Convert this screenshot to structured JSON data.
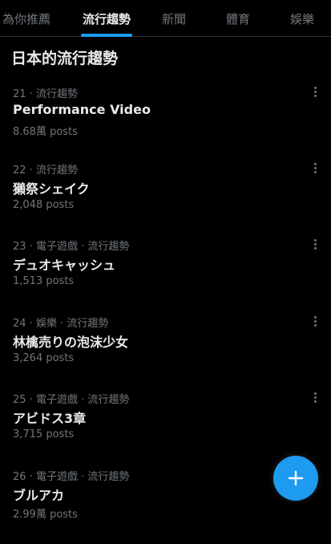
{
  "tabs": [
    {
      "label": "為你推薦",
      "active": false
    },
    {
      "label": "流行趨勢",
      "active": true
    },
    {
      "label": "新聞",
      "active": false
    },
    {
      "label": "體育",
      "active": false
    },
    {
      "label": "娛樂",
      "active": false
    }
  ],
  "section_title": "日本的流行趨勢",
  "trends": [
    {
      "rank": "21",
      "category": "流行趨勢",
      "name": "Performance Video",
      "posts": "8.68萬 posts"
    },
    {
      "rank": "22",
      "category": "流行趨勢",
      "name": "獺祭シェイク",
      "posts": "2,048 posts"
    },
    {
      "rank": "23",
      "category": "電子遊戲 · 流行趨勢",
      "name": "デュオキャッシュ",
      "posts": "1,513 posts"
    },
    {
      "rank": "24",
      "category": "娛樂 · 流行趨勢",
      "name": "林檎売りの泡沫少女",
      "posts": "3,264 posts"
    },
    {
      "rank": "25",
      "category": "電子遊戲 · 流行趨勢",
      "name": "アビドス3章",
      "posts": "3,715 posts"
    },
    {
      "rank": "26",
      "category": "電子遊戲 · 流行趨勢",
      "name": "ブルアカ",
      "posts": "2.99萬 posts"
    }
  ],
  "colors": {
    "accent": "#1d9bf0",
    "background": "#000000",
    "text": "#e7e9ea",
    "muted": "#71767b"
  },
  "fab_icon": "plus-icon"
}
